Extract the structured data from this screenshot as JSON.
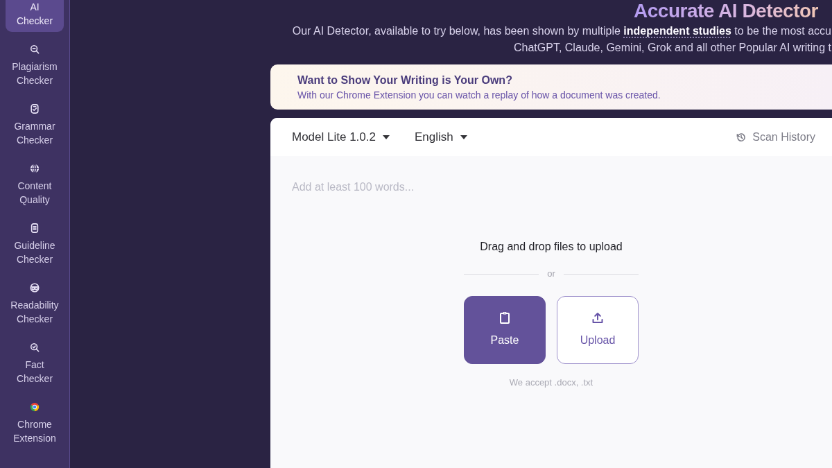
{
  "sidebar": {
    "items": [
      {
        "label": "AI Checker",
        "selected": true
      },
      {
        "label": "Plagiarism Checker",
        "selected": false
      },
      {
        "label": "Grammar Checker",
        "selected": false
      },
      {
        "label": "Content Quality",
        "selected": false
      },
      {
        "label": "Guideline Checker",
        "selected": false
      },
      {
        "label": "Readability Checker",
        "selected": false
      },
      {
        "label": "Fact Checker",
        "selected": false
      },
      {
        "label": "Chrome Extension",
        "selected": false
      }
    ]
  },
  "header": {
    "title": "Accurate AI Detector",
    "intro": {
      "text_before": "Our AI Detector, available to try below, has been shown by multiple ",
      "link": "independent studies",
      "text_after": " to be the most accu",
      "line_2": "ChatGPT, Claude, Gemini, Grok and all other Popular AI writing t"
    }
  },
  "banner": {
    "title": "Want to Show Your Writing is Your Own?",
    "text": "With our Chrome Extension you can watch a replay of how a document was created."
  },
  "checker": {
    "model_dropdown": "Model Lite 1.0.2",
    "language_dropdown": "English",
    "scan_history": "Scan History",
    "text_input": {
      "placeholder": "Add at least 100 words..."
    },
    "drop_zone": {
      "prompt": "Drag and drop files to upload",
      "divider": "or",
      "buttons": [
        {
          "label": "Paste",
          "kind": "primary"
        },
        {
          "label": "Upload",
          "kind": "outline"
        }
      ],
      "note": "We accept .docx, .txt"
    }
  }
}
